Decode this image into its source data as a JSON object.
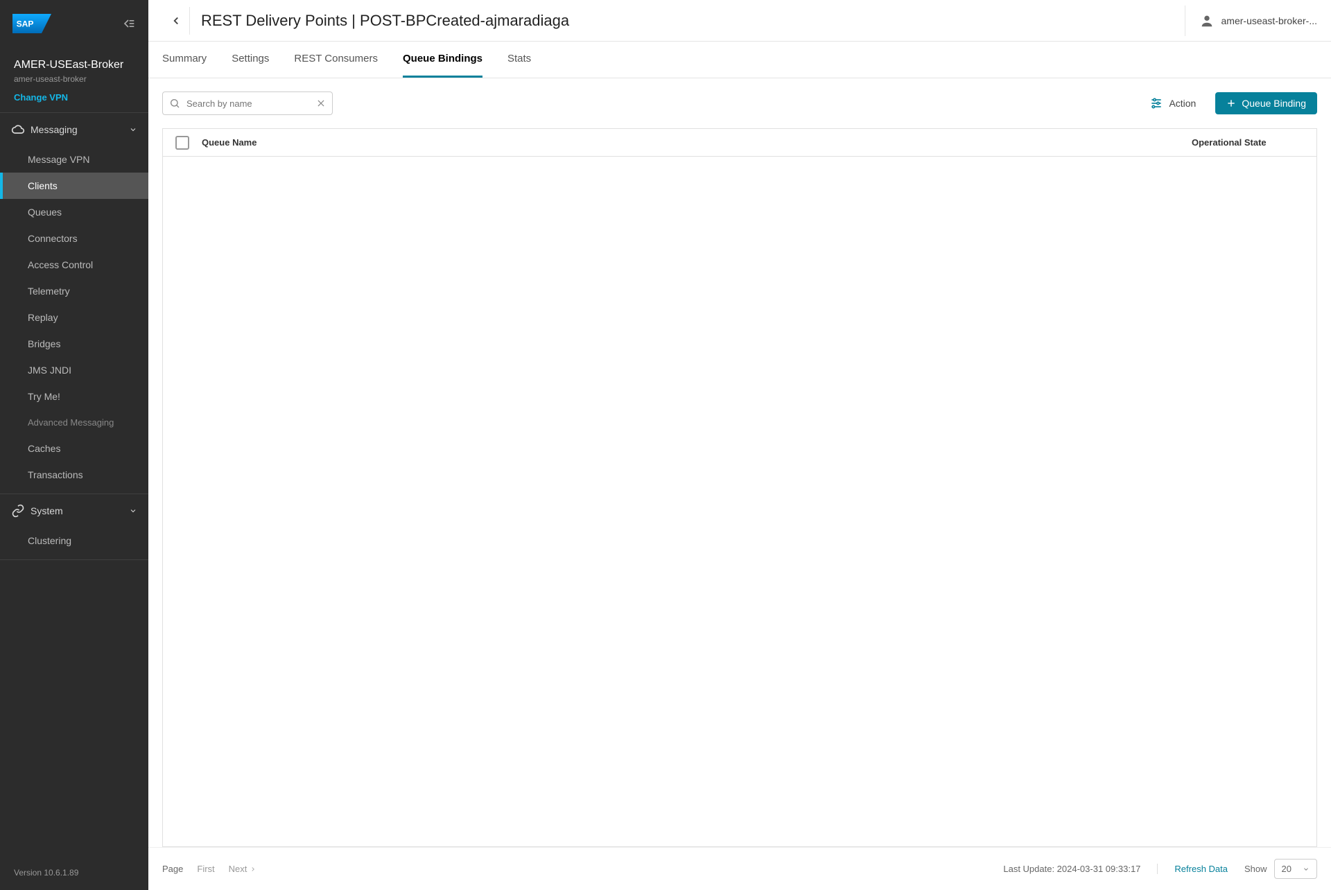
{
  "sidebar": {
    "broker_name": "AMER-USEast-Broker",
    "broker_subtitle": "amer-useast-broker",
    "change_vpn": "Change VPN",
    "sections": {
      "messaging": {
        "title": "Messaging",
        "items": [
          "Message VPN",
          "Clients",
          "Queues",
          "Connectors",
          "Access Control",
          "Telemetry",
          "Replay",
          "Bridges",
          "JMS JNDI",
          "Try Me!"
        ],
        "advanced_label": "Advanced Messaging",
        "advanced_items": [
          "Caches",
          "Transactions"
        ]
      },
      "system": {
        "title": "System",
        "items": [
          "Clustering"
        ]
      }
    },
    "version": "Version 10.6.1.89"
  },
  "header": {
    "title": "REST Delivery Points | POST-BPCreated-ajmaradiaga",
    "user": "amer-useast-broker-..."
  },
  "tabs": [
    "Summary",
    "Settings",
    "REST Consumers",
    "Queue Bindings",
    "Stats"
  ],
  "active_tab_index": 3,
  "toolbar": {
    "search_placeholder": "Search by name",
    "action_label": "Action",
    "queue_binding_label": "Queue Binding"
  },
  "table": {
    "columns": {
      "name": "Queue Name",
      "state": "Operational State"
    }
  },
  "footer": {
    "page_label": "Page",
    "first_label": "First",
    "next_label": "Next",
    "last_update": "Last Update: 2024-03-31 09:33:17",
    "refresh_label": "Refresh Data",
    "show_label": "Show",
    "page_size": "20"
  }
}
